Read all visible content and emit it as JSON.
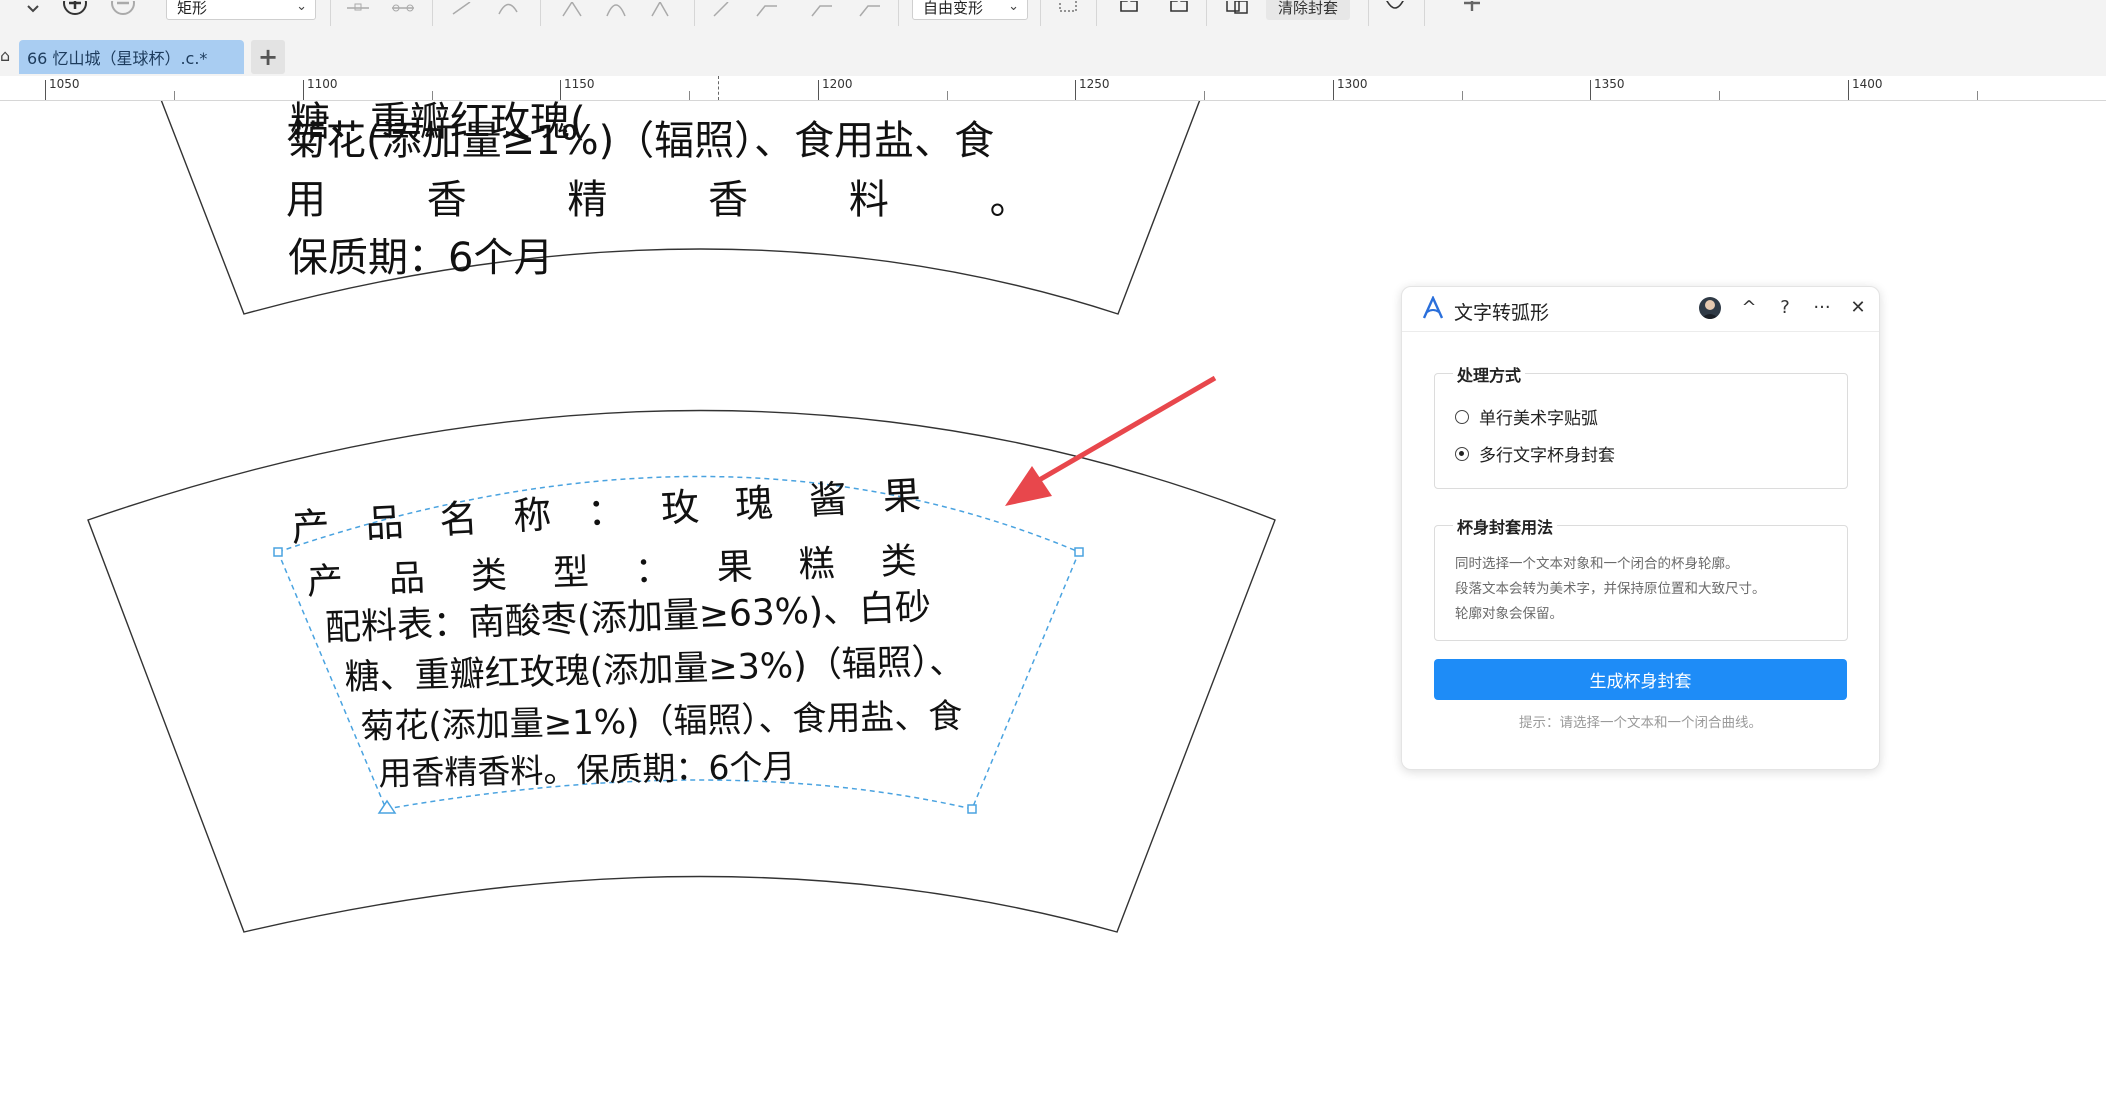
{
  "toolbar": {
    "shape_select": "矩形",
    "transform_select": "自由变形",
    "clear_envelope_label": "清除封套"
  },
  "tabs": [
    {
      "label": "66 忆山城（星球杯）.c.*"
    }
  ],
  "ruler": {
    "labels": [
      "1050",
      "1100",
      "1150",
      "1200",
      "1250",
      "1300",
      "1350",
      "1400"
    ]
  },
  "canvas": {
    "upper_cup": {
      "lines": [
        "糖、重瓣红玫瑰(",
        "菊花(添加量≥1%)（辐照）、食用盐、食",
        "用  香  精  香  料  。",
        "保质期：6个月"
      ]
    },
    "lower_cup": {
      "lines": [
        "产品名称：玫瑰酱果",
        "产品类型：果糕类",
        "配料表：南酸枣(添加量≥63%)、白砂",
        "糖、重瓣红玫瑰(添加量≥3%)（辐照）、",
        "菊花(添加量≥1%)（辐照）、食用盐、食",
        "用香精香料。保质期：6个月"
      ]
    }
  },
  "panel": {
    "title": "文字转弧形",
    "header_buttons": {
      "collapse": "^",
      "help": "?",
      "more": "···",
      "close": "✕"
    },
    "mode_group": {
      "title": "处理方式",
      "options": [
        {
          "label": "单行美术字贴弧",
          "selected": false
        },
        {
          "label": "多行文字杯身封套",
          "selected": true
        }
      ]
    },
    "usage_group": {
      "title": "杯身封套用法",
      "lines": [
        "同时选择一个文本对象和一个闭合的杯身轮廓。",
        "段落文本会转为美术字，并保持原位置和大致尺寸。",
        "轮廓对象会保留。"
      ]
    },
    "primary_button": "生成杯身封套",
    "hint": "提示：请选择一个文本和一个闭合曲线。"
  },
  "colors": {
    "accent": "#1e8cf7",
    "selection": "#4aa3e0",
    "arrow": "#e8474c",
    "tab_active": "#a9cdf2"
  }
}
